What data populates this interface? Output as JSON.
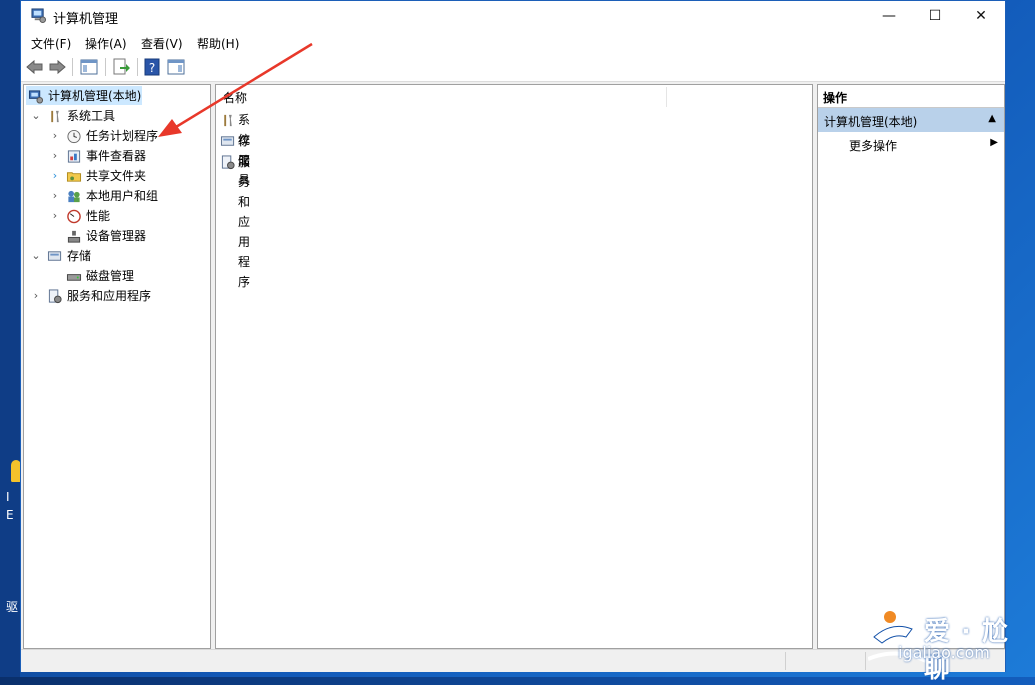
{
  "window": {
    "title": "计算机管理"
  },
  "menu": [
    "文件(F)",
    "操作(A)",
    "查看(V)",
    "帮助(H)"
  ],
  "window_buttons": {
    "minimize": "—",
    "maximize": "☐",
    "close": "✕"
  },
  "tree": {
    "root": "计算机管理(本地)",
    "system_tools": "系统工具",
    "system_tools_children": [
      "任务计划程序",
      "事件查看器",
      "共享文件夹",
      "本地用户和组",
      "性能",
      "设备管理器"
    ],
    "storage": "存储",
    "storage_children": [
      "磁盘管理"
    ],
    "services": "服务和应用程序"
  },
  "list": {
    "column_name": "名称",
    "rows": [
      "系统工具",
      "存储",
      "服务和应用程序"
    ]
  },
  "actions": {
    "header": "操作",
    "section": "计算机管理(本地)",
    "more": "更多操作"
  },
  "desktop": {
    "left_chars": [
      "I",
      "E",
      "驱"
    ],
    "watermark_cn": "爱 · 尬聊",
    "watermark_url": "igaliao.com"
  },
  "colors": {
    "selection": "#cce8ff",
    "action_section": "#b9d1ea",
    "annotation_arrow": "#e8382a"
  }
}
